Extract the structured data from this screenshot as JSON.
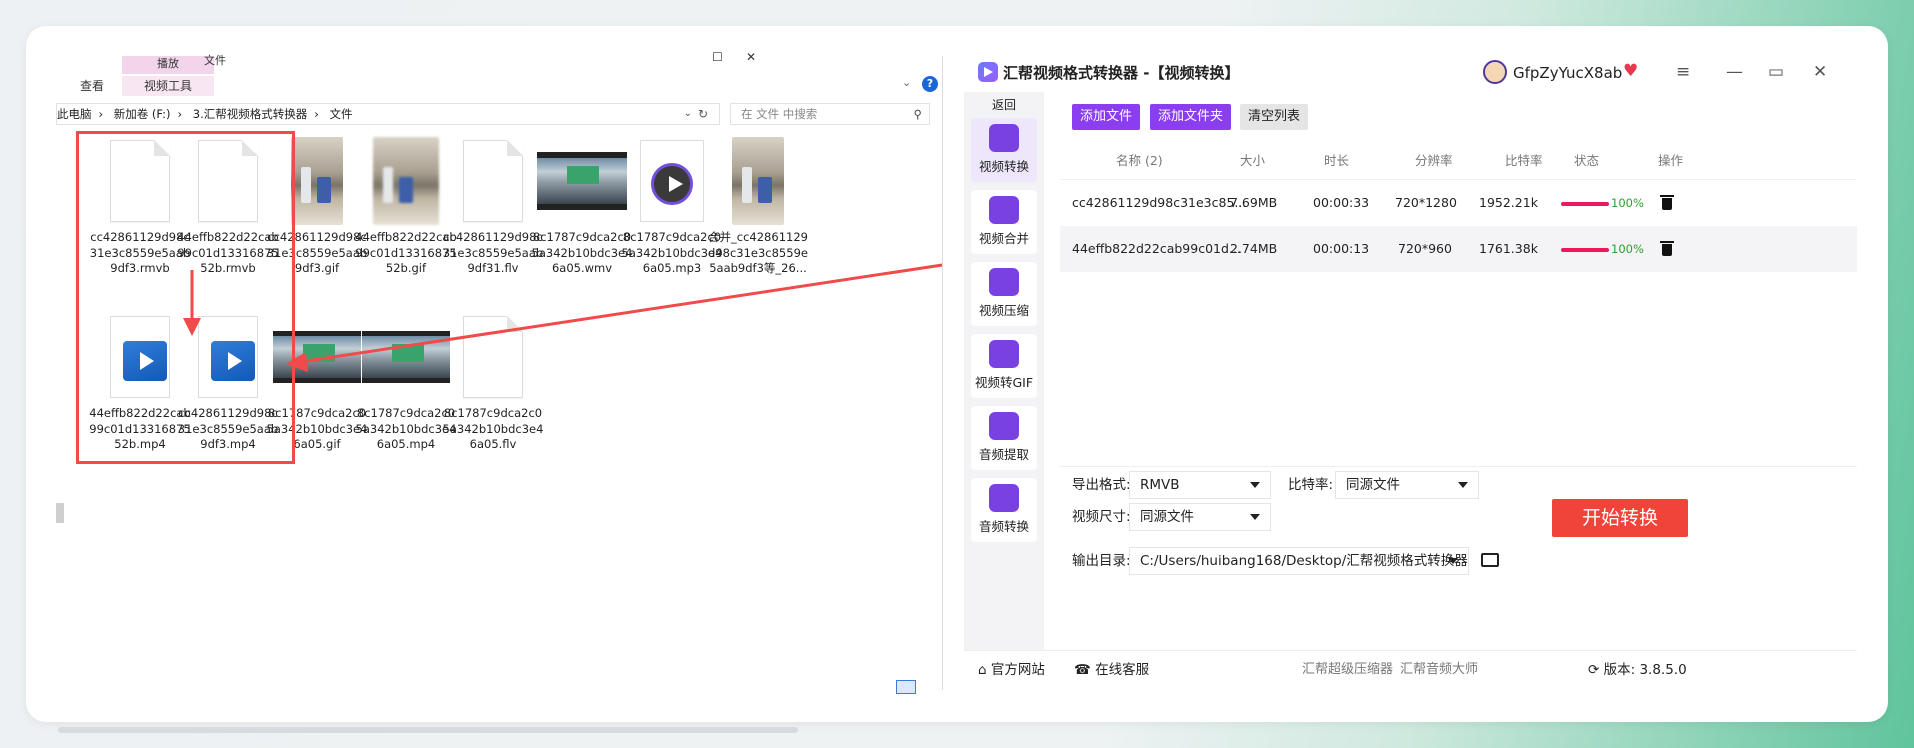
{
  "explorer": {
    "ribbon": {
      "ctx_tab": "播放",
      "ctx_title": "文件",
      "tab_view": "查看",
      "tab_video_tools": "视频工具"
    },
    "address": [
      "此电脑",
      "新加卷 (F:)",
      "3.汇帮视频格式转换器",
      "文件"
    ],
    "search_placeholder": "在 文件 中搜索",
    "files": [
      {
        "name": "cc42861129d98c31e3c8559e5aab9df3.rmvb",
        "icon": "blank-doc-icon"
      },
      {
        "name": "44effb822d22cab99c01d1331687552b.rmvb",
        "icon": "blank-doc-icon"
      },
      {
        "name": "cc42861129d98c31e3c8559e5aab9df3.gif",
        "icon": "photo-thumbnail"
      },
      {
        "name": "44effb822d22cab99c01d1331687552b.gif",
        "icon": "photo-thumbnail"
      },
      {
        "name": "cc42861129d98c31e3c8559e5aab9df31.flv",
        "icon": "blank-doc-icon"
      },
      {
        "name": "8c1787c9dca2c05a342b10bdc3e46a05.wmv",
        "icon": "video-thumbnail"
      },
      {
        "name": "8c1787c9dca2c05a342b10bdc3e46a05.mp3",
        "icon": "audio-play-icon"
      },
      {
        "name": "合并_cc42861129d98c31e3c8559e5aab9df3等_26...",
        "icon": "photo-thumbnail"
      },
      {
        "name": "44effb822d22cab99c01d1331687552b.mp4",
        "icon": "mp4-play-icon"
      },
      {
        "name": "cc42861129d98c31e3c8559e5aab9df3.mp4",
        "icon": "mp4-play-icon"
      },
      {
        "name": "8c1787c9dca2c05a342b10bdc3e46a05.gif",
        "icon": "video-thumbnail"
      },
      {
        "name": "8c1787c9dca2c05a342b10bdc3e46a05.mp4",
        "icon": "video-thumbnail"
      },
      {
        "name": "8c1787c9dca2c05a342b10bdc3e46a05.flv",
        "icon": "blank-doc-icon"
      }
    ],
    "highlight_color": "#f04a4a"
  },
  "app": {
    "title": "汇帮视频格式转换器  -【视频转换】",
    "username": "GfpZyYucX8ab",
    "back_label": "返回",
    "sidebar": [
      {
        "label": "视频转换",
        "icon": "video-convert-icon",
        "active": true
      },
      {
        "label": "视频合并",
        "icon": "video-merge-icon",
        "active": false
      },
      {
        "label": "视频压缩",
        "icon": "video-compress-icon",
        "active": false
      },
      {
        "label": "视频转GIF",
        "icon": "gif-icon",
        "active": false
      },
      {
        "label": "音频提取",
        "icon": "music-note-icon",
        "active": false
      },
      {
        "label": "音频转换",
        "icon": "microphone-icon",
        "active": false
      }
    ],
    "actions": {
      "add_file": "添加文件",
      "add_folder": "添加文件夹",
      "clear_list": "清空列表"
    },
    "table": {
      "headers": [
        "名称 (2)",
        "大小",
        "时长",
        "分辨率",
        "比特率",
        "状态",
        "操作"
      ],
      "rows": [
        {
          "name": "cc42861129d98c31e3c85...",
          "size": "7.69MB",
          "duration": "00:00:33",
          "resolution": "720*1280",
          "bitrate": "1952.21k",
          "progress": "100%"
        },
        {
          "name": "44effb822d22cab99c01d...",
          "size": "2.74MB",
          "duration": "00:00:13",
          "resolution": "720*960",
          "bitrate": "1761.38k",
          "progress": "100%"
        }
      ]
    },
    "settings": {
      "format_label": "导出格式:",
      "format_value": "RMVB",
      "bitrate_label": "比特率:",
      "bitrate_value": "同源文件",
      "size_label": "视频尺寸:",
      "size_value": "同源文件",
      "output_label": "输出目录:",
      "output_value": "C:/Users/huibang168/Desktop/汇帮视频格式转换器",
      "start_label": "开始转换"
    },
    "footer": {
      "website": "官方网站",
      "service": "在线客服",
      "link1": "汇帮超级压缩器",
      "link2": "汇帮音频大师",
      "version": "版本: 3.8.5.0"
    },
    "colors": {
      "accent": "#8a3ef0",
      "start": "#f0433a",
      "progress": "#e8195c"
    }
  }
}
